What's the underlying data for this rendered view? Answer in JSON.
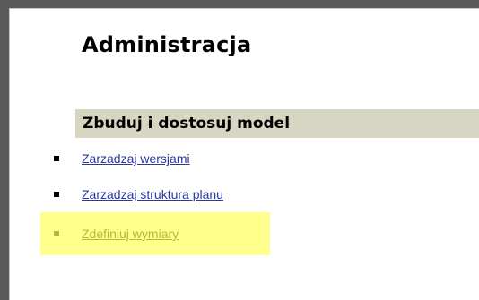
{
  "page": {
    "title": "Administracja"
  },
  "section": {
    "header": "Zbuduj i dostosuj model",
    "items": [
      {
        "label": "Zarzadzaj wersjami",
        "enabled": true
      },
      {
        "label": "Zarzadzaj struktura planu",
        "enabled": true
      },
      {
        "label": "Zdefiniuj wymiary",
        "enabled": false,
        "highlighted": true
      }
    ]
  },
  "colors": {
    "frame": "#5a5a5a",
    "section_header_bg": "#d6d6c2",
    "link": "#2a3a9c",
    "disabled_link": "#b8b838",
    "highlight": "#ffff8c"
  }
}
